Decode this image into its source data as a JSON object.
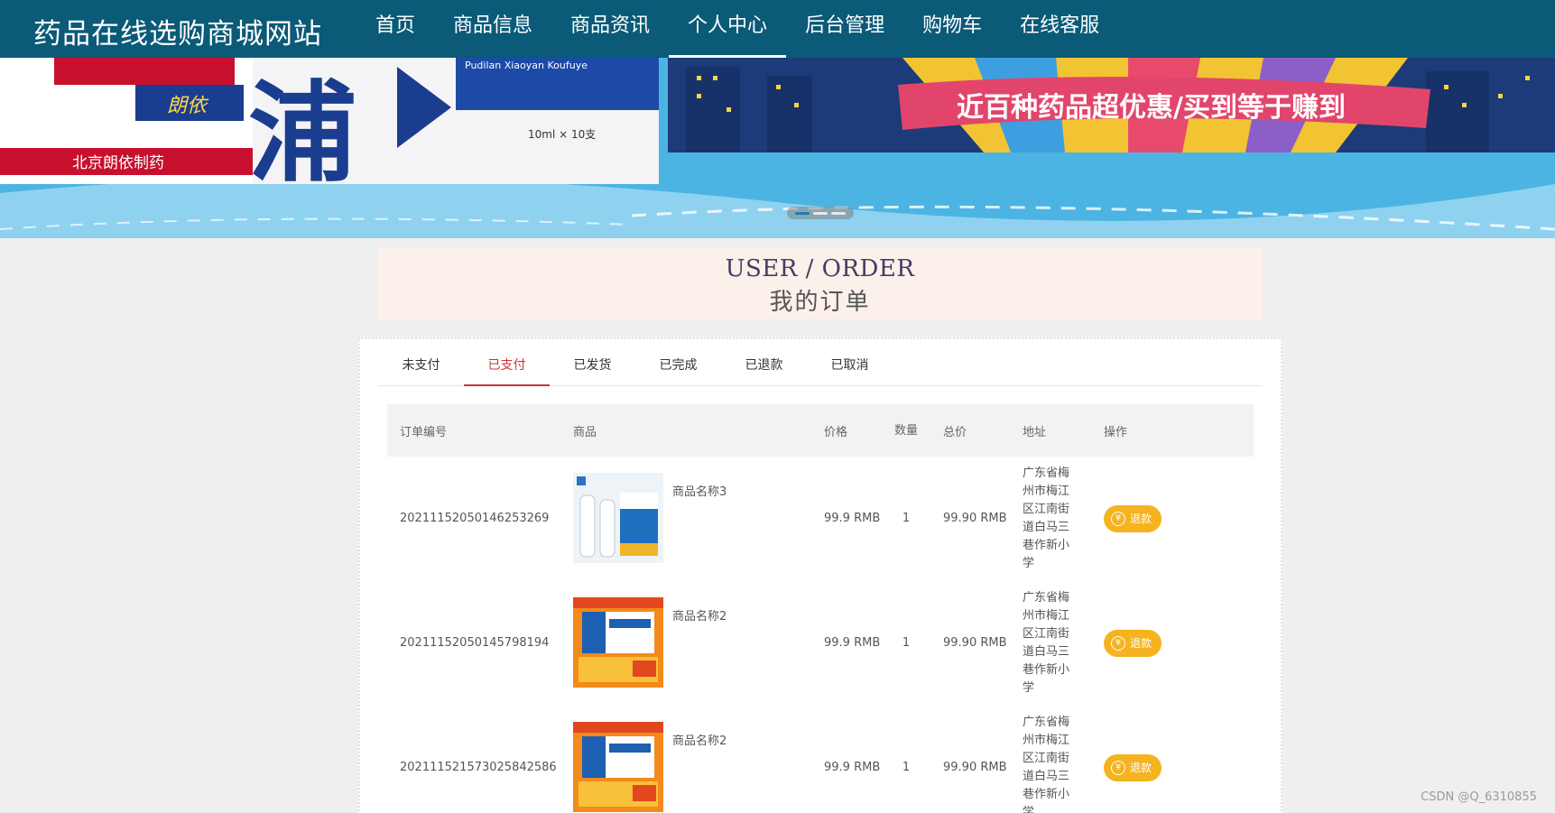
{
  "header": {
    "site_title": "药品在线选购商城网站",
    "nav": [
      {
        "label": "首页"
      },
      {
        "label": "商品信息"
      },
      {
        "label": "商品资讯"
      },
      {
        "label": "个人中心",
        "active": true
      },
      {
        "label": "后台管理"
      },
      {
        "label": "购物车"
      },
      {
        "label": "在线客服"
      }
    ]
  },
  "banner": {
    "product_brand": "朗依",
    "product_char": "浦",
    "product_pinyin": "Pudilan Xiaoyan Koufuye",
    "product_spec": "10ml × 10支",
    "company": "北京朗依制药",
    "slogan": "近百种药品超优惠/买到等于赚到"
  },
  "heading": {
    "en": "USER / ORDER",
    "cn": "我的订单"
  },
  "tabs": [
    {
      "label": "未支付"
    },
    {
      "label": "已支付",
      "active": true
    },
    {
      "label": "已发货"
    },
    {
      "label": "已完成"
    },
    {
      "label": "已退款"
    },
    {
      "label": "已取消"
    }
  ],
  "table": {
    "columns": {
      "id": "订单编号",
      "goods": "商品",
      "price": "价格",
      "qty": "数量",
      "total": "总价",
      "address": "地址",
      "action": "操作"
    },
    "rows": [
      {
        "id": "20211152050146253269",
        "goods_name": "商品名称3",
        "thumb": "spray",
        "price": "99.9 RMB",
        "qty": "1",
        "total": "99.90 RMB",
        "address": "广东省梅州市梅江区江南街道白马三巷作新小学",
        "action": "退款"
      },
      {
        "id": "20211152050145798194",
        "goods_name": "商品名称2",
        "thumb": "capsule",
        "price": "99.9 RMB",
        "qty": "1",
        "total": "99.90 RMB",
        "address": "广东省梅州市梅江区江南街道白马三巷作新小学",
        "action": "退款"
      },
      {
        "id": "20211152157302584258​6",
        "goods_name": "商品名称2",
        "thumb": "capsule",
        "price": "99.9 RMB",
        "qty": "1",
        "total": "99.90 RMB",
        "address": "广东省梅州市梅江区江南街道白马三巷作新小学",
        "action": "退款"
      }
    ]
  },
  "watermark": "CSDN @Q_6310855",
  "colors": {
    "header_bg": "#0a5a78",
    "active_tab": "#cc3333",
    "refund_button": "#f5b31f",
    "heading_bg": "#fcf0ea"
  }
}
